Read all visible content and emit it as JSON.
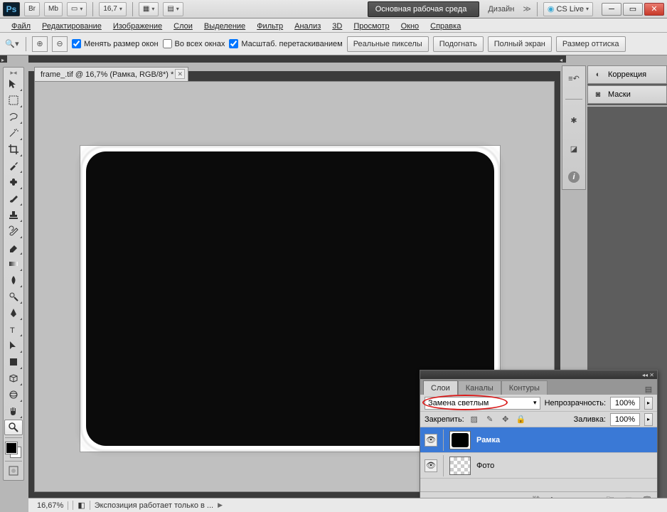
{
  "titlebar": {
    "br": "Br",
    "mb": "Mb",
    "zoom_pct": "16,7",
    "workspace_primary": "Основная рабочая среда",
    "workspace_design": "Дизайн",
    "more": "≫",
    "cslive": "CS Live"
  },
  "menu": {
    "file": "Файл",
    "edit": "Редактирование",
    "image": "Изображение",
    "layer": "Слои",
    "select": "Выделение",
    "filter": "Фильтр",
    "analysis": "Анализ",
    "threeD": "3D",
    "view": "Просмотр",
    "window": "Окно",
    "help": "Справка"
  },
  "opt": {
    "resize_windows": "Менять размер окон",
    "all_windows": "Во всех окнах",
    "scrubby_zoom": "Масштаб. перетаскиванием",
    "actual_pixels": "Реальные пикселы",
    "fit_screen": "Подогнать",
    "full_screen": "Полный экран",
    "print_size": "Размер оттиска"
  },
  "doc": {
    "tab": "frame_.tif @ 16,7% (Рамка, RGB/8*) *"
  },
  "rightpanels": {
    "adjustments": "Коррекция",
    "masks": "Маски"
  },
  "layers": {
    "tab_layers": "Слои",
    "tab_channels": "Каналы",
    "tab_paths": "Контуры",
    "blend_mode": "Замена светлым",
    "opacity_label": "Непрозрачность:",
    "opacity_val": "100%",
    "lock_label": "Закрепить:",
    "fill_label": "Заливка:",
    "fill_val": "100%",
    "layer1": "Рамка",
    "layer2": "Фото"
  },
  "status": {
    "zoom": "16,67%",
    "info": "Экспозиция работает только в ..."
  }
}
